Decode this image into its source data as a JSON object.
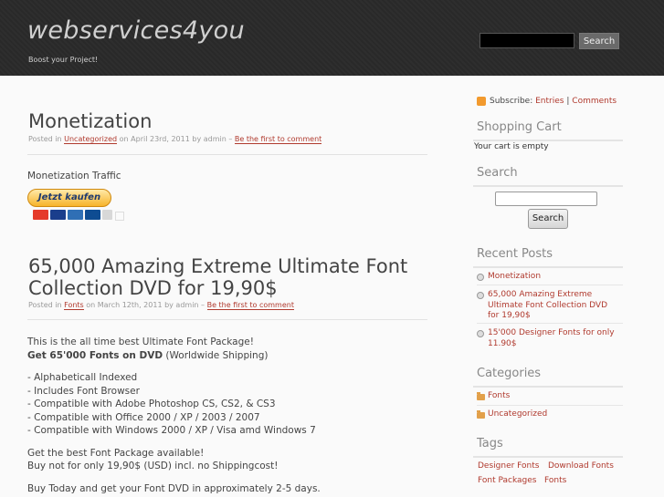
{
  "header": {
    "site_title": "webservices4you",
    "tagline": "Boost your Project!",
    "search_button": "Search"
  },
  "posts": [
    {
      "title": "Monetization",
      "meta_prefix": "Posted in",
      "category": "Uncategorized",
      "meta_middle": "on April 23rd, 2011 by admin –",
      "comment_link": "Be the first to comment",
      "body_text": "Monetization Traffic",
      "paypal_button": "Jetzt kaufen"
    },
    {
      "title_line1": "65,000 Amazing Extreme Ultimate Font",
      "title_line2": "Collection DVD for 19,90$",
      "meta_prefix": "Posted in",
      "category": "Fonts",
      "meta_middle": "on March 12th, 2011 by admin –",
      "comment_link": "Be the first to comment",
      "p1": "This is the all time best Ultimate Font Package!",
      "p2_bold": "Get 65'000 Fonts on DVD",
      "p2_rest": " (Worldwide Shipping)",
      "features": [
        "- Alphabeticall Indexed",
        "- Includes Font Browser",
        "- Compatible with Adobe Photoshop CS, CS2, & CS3",
        "- Compatible with Office 2000 / XP / 2003 / 2007",
        "- Compatible with Windows 2000 / XP / Visa amd Windows 7"
      ],
      "p3": "Get the best Font Package available!",
      "p4": "Buy not for only 19,90$ (USD) incl. no Shippingcost!",
      "p5": "Buy Today and get your Font DVD in approximately 2-5 days."
    }
  ],
  "sidebar": {
    "subscribe_label": "Subscribe:",
    "entries_link": "Entries",
    "separator": "|",
    "comments_link": "Comments",
    "cart_heading": "Shopping Cart",
    "cart_text": "Your cart is empty",
    "search_heading": "Search",
    "search_button": "Search",
    "recent_heading": "Recent Posts",
    "recent_posts": [
      "Monetization",
      "65,000 Amazing Extreme Ultimate Font Collection DVD for 19,90$",
      "15'000 Designer Fonts for only 11.90$"
    ],
    "categories_heading": "Categories",
    "categories": [
      "Fonts",
      "Uncategorized"
    ],
    "tags_heading": "Tags",
    "tags": [
      "Designer Fonts",
      "Download Fonts",
      "Font Packages",
      "Fonts"
    ]
  }
}
